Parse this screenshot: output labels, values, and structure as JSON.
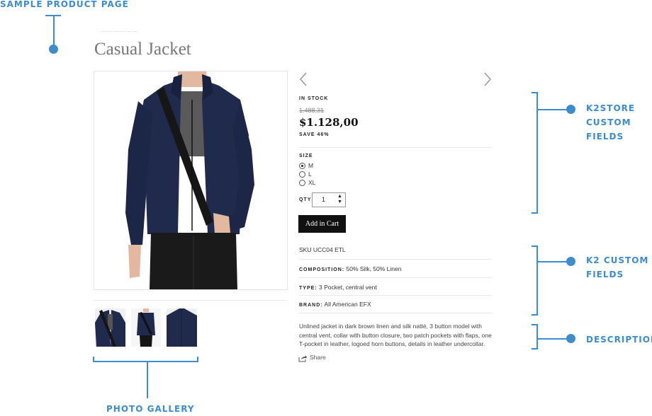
{
  "annotations": {
    "sample_page": "SAMPLE PRODUCT PAGE",
    "k2store_lines": [
      "K2STORE",
      "CUSTOM",
      "FIELDS"
    ],
    "k2_lines": [
      "K2 CUSTOM",
      "FIELDS"
    ],
    "description": "DESCRIPTION",
    "photo_gallery": "PHOTO GALLERY"
  },
  "product": {
    "title": "Casual Jacket",
    "stock": "IN STOCK",
    "old_price": "1.488,31",
    "price": "$1.128,00",
    "save": "SAVE 46%",
    "size_label": "SIZE",
    "sizes": [
      {
        "label": "M",
        "selected": true
      },
      {
        "label": "L",
        "selected": false
      },
      {
        "label": "XL",
        "selected": false
      }
    ],
    "qty_label": "QTY",
    "qty_value": "1",
    "add_to_cart": "Add in Cart",
    "sku": "SKU UCC04 ETL",
    "composition_label": "COMPOSITION:",
    "composition_value": "50% Silk, 50% Linen",
    "type_label": "TYPE:",
    "type_value": "3 Pocket, central vent",
    "brand_label": "BRAND:",
    "brand_value": "All American EFX",
    "description_lines": [
      "Unlined jacket in dark brown linen and silk natté, 3 button model with",
      "central vent, collar with button closure, two patch pockets with flaps, one",
      "T-pocket in leather, logoed horn buttons, details in leather undercollar."
    ],
    "share": "Share"
  },
  "colors": {
    "accent": "#3d8ccb",
    "jacket": "#1f2a4d",
    "button": "#111111"
  },
  "icons": [
    "chevron-left-icon",
    "chevron-right-icon",
    "share-icon",
    "stepper-icon"
  ]
}
